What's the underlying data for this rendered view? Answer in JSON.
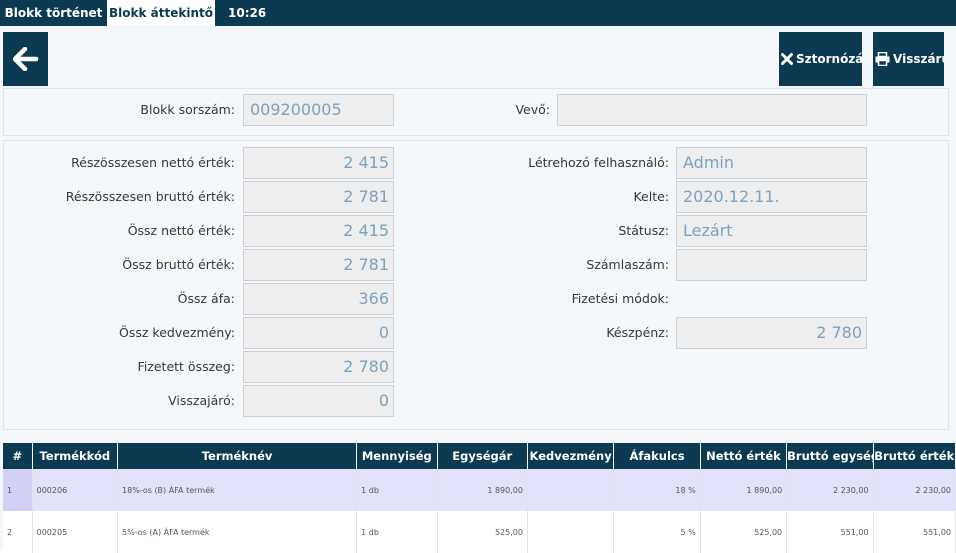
{
  "tabs": [
    {
      "label": "Blokk történet"
    },
    {
      "label": "Blokk áttekintő"
    }
  ],
  "clock": "10:26",
  "buttons": {
    "storno": "Sztornózás",
    "return": "Visszáru"
  },
  "header": {
    "serial_label": "Blokk sorszám:",
    "serial_value": "009200005",
    "buyer_label": "Vevő:",
    "buyer_value": ""
  },
  "left_fields": [
    {
      "label": "Részösszesen nettó érték:",
      "value": "2 415"
    },
    {
      "label": "Részösszesen bruttó érték:",
      "value": "2 781"
    },
    {
      "label": "Össz nettó érték:",
      "value": "2 415"
    },
    {
      "label": "Össz bruttó érték:",
      "value": "2 781"
    },
    {
      "label": "Össz áfa:",
      "value": "366"
    },
    {
      "label": "Össz kedvezmény:",
      "value": "0"
    },
    {
      "label": "Fizetett összeg:",
      "value": "2 780"
    },
    {
      "label": "Visszajáró:",
      "value": "0"
    }
  ],
  "right_fields": {
    "creator_label": "Létrehozó felhasználó:",
    "creator_value": "Admin",
    "date_label": "Kelte:",
    "date_value": "2020.12.11.",
    "status_label": "Státusz:",
    "status_value": "Lezárt",
    "invoice_label": "Számlaszám:",
    "invoice_value": "",
    "payment_label": "Fizetési módok:",
    "cash_label": "Készpénz:",
    "cash_value": "2 780"
  },
  "table": {
    "columns": [
      "#",
      "Termékkód",
      "Terméknév",
      "Mennyiség",
      "Egységár",
      "Kedvezmény",
      "Áfakulcs",
      "Nettó érték",
      "Bruttó egységár",
      "Bruttó érték"
    ],
    "rows": [
      [
        "1",
        "000206",
        "18%-os (B) ÁFA termék",
        "1 db",
        "1 890,00",
        "",
        "18 %",
        "1 890,00",
        "2 230,00",
        "2 230,00"
      ],
      [
        "2",
        "000205",
        "5%-os (A) ÁFA termék",
        "1 db",
        "525,00",
        "",
        "5 %",
        "525,00",
        "551,00",
        "551,00"
      ]
    ]
  },
  "colors": {
    "primary": "#0c3a52",
    "field_text": "#7aa3bf",
    "selected_row": "#e3e2fb"
  },
  "icons": {
    "back": "arrow-left-icon",
    "storno": "close-icon",
    "return": "print-icon"
  }
}
